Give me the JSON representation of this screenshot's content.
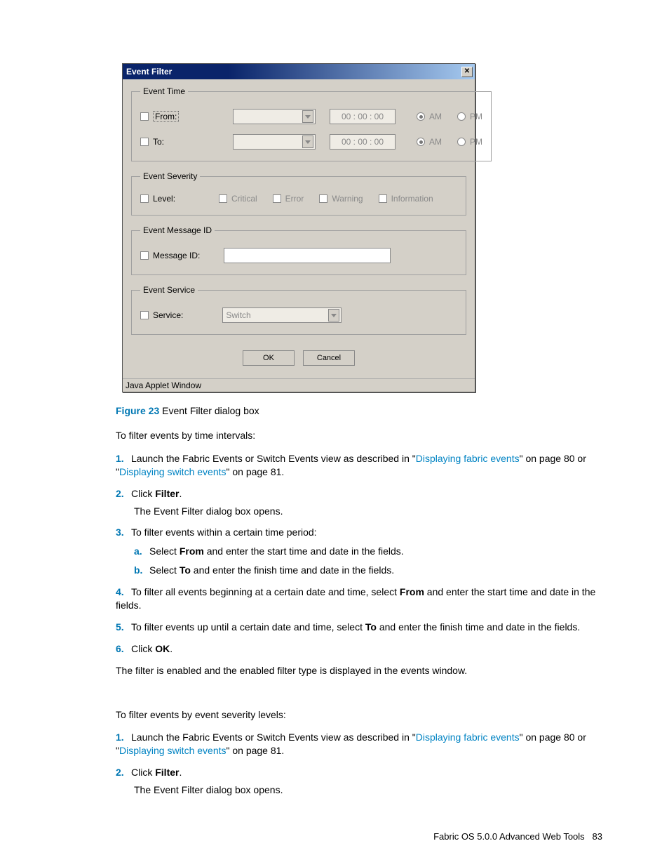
{
  "dialog": {
    "title": "Event Filter",
    "close": "✕",
    "groups": {
      "time": {
        "legend": "Event Time",
        "from": "From:",
        "to": "To:",
        "timeval": "00 : 00 : 00",
        "am": "AM",
        "pm": "PM"
      },
      "severity": {
        "legend": "Event Severity",
        "level": "Level:",
        "critical": "Critical",
        "error": "Error",
        "warning": "Warning",
        "info": "Information"
      },
      "msg": {
        "legend": "Event Message ID",
        "label": "Message ID:"
      },
      "svc": {
        "legend": "Event Service",
        "label": "Service:",
        "value": "Switch"
      }
    },
    "buttons": {
      "ok": "OK",
      "cancel": "Cancel"
    },
    "status": "Java Applet Window"
  },
  "caption": {
    "prefix": "Figure 23",
    "text": " Event Filter dialog box"
  },
  "intro1": "To filter events by time intervals:",
  "steps1": {
    "s1a": "Launch the Fabric Events or Switch Events view as described in \"",
    "s1link1": "Displaying fabric events",
    "s1b": "\" on page 80 or \"",
    "s1link2": "Displaying switch events",
    "s1c": "\" on page 81.",
    "s2a": "Click ",
    "s2b": "Filter",
    "s2c": ".",
    "s2d": "The Event Filter dialog box opens.",
    "s3": "To filter events within a certain time period:",
    "s3a1": "Select ",
    "s3a2": "From",
    "s3a3": " and enter the start time and date in the fields.",
    "s3b1": "Select ",
    "s3b2": "To",
    "s3b3": " and enter the finish time and date in the fields.",
    "s4a": "To filter all events beginning at a certain date and time, select ",
    "s4b": "From",
    "s4c": " and enter the start time and date in the fields.",
    "s5a": "To filter events up until a certain date and time, select ",
    "s5b": "To",
    "s5c": " and enter the finish time and date in the fields.",
    "s6a": "Click ",
    "s6b": "OK",
    "s6c": "."
  },
  "after1": "The filter is enabled and the enabled filter type is displayed in the events window.",
  "intro2": "To filter events by event severity levels:",
  "steps2": {
    "s1a": "Launch the Fabric Events or Switch Events view as described in \"",
    "s1link1": "Displaying fabric events",
    "s1b": "\" on page 80 or \"",
    "s1link2": "Displaying switch events",
    "s1c": "\" on page 81.",
    "s2a": "Click ",
    "s2b": "Filter",
    "s2c": ".",
    "s2d": "The Event Filter dialog box opens."
  },
  "footer": "Fabric OS 5.0.0 Advanced Web Tools",
  "page": "83"
}
